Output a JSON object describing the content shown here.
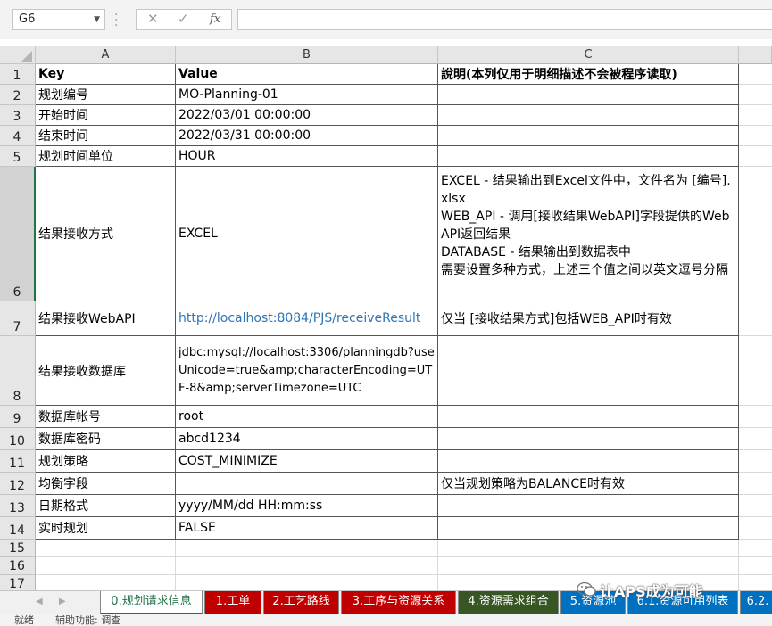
{
  "formula_bar": {
    "name_box": "G6",
    "cancel_icon": "✕",
    "enter_icon": "✓",
    "fx_label": "fx",
    "formula": ""
  },
  "columns": [
    "A",
    "B",
    "C"
  ],
  "rows": [
    {
      "num": "1",
      "a": "Key",
      "b": "Value",
      "c": "說明(本列仅用于明细描述不会被程序读取)"
    },
    {
      "num": "2",
      "a": "规划编号",
      "b": "MO-Planning-01",
      "c": ""
    },
    {
      "num": "3",
      "a": "开始时间",
      "b": "2022/03/01 00:00:00",
      "c": ""
    },
    {
      "num": "4",
      "a": "结束时间",
      "b": "2022/03/31 00:00:00",
      "c": ""
    },
    {
      "num": "5",
      "a": "规划时间单位",
      "b": " HOUR",
      "c": ""
    },
    {
      "num": "6",
      "a": "结果接收方式",
      "b": "EXCEL",
      "c": "EXCEL - 结果输出到Excel文件中，文件名为 [编号].xlsx\nWEB_API - 调用[接收结果WebAPI]字段提供的WebAPI返回结果\nDATABASE - 结果输出到数据表中\n需要设置多种方式，上述三个值之间以英文逗号分隔"
    },
    {
      "num": "7",
      "a": "结果接收WebAPI",
      "b": "http://localhost:8084/PJS/receiveResult",
      "c": "仅当 [接收结果方式]包括WEB_API时有效"
    },
    {
      "num": "8",
      "a": "结果接收数据库",
      "b": "jdbc:mysql://localhost:3306/planningdb?useUnicode=true&amp;characterEncoding=UTF-8&amp;serverTimezone=UTC",
      "c": ""
    },
    {
      "num": "9",
      "a": "数据库帐号",
      "b": " root",
      "c": ""
    },
    {
      "num": "10",
      "a": "数据库密码",
      "b": "abcd1234",
      "c": ""
    },
    {
      "num": "11",
      "a": "规划策略",
      "b": "COST_MINIMIZE",
      "c": ""
    },
    {
      "num": "12",
      "a": "均衡字段",
      "b": "",
      "c": "仅当规划策略为BALANCE时有效"
    },
    {
      "num": "13",
      "a": "日期格式",
      "b": " yyyy/MM/dd HH:mm:ss",
      "c": ""
    },
    {
      "num": "14",
      "a": "实时规划",
      "b": "FALSE",
      "c": ""
    },
    {
      "num": "15",
      "a": "",
      "b": "",
      "c": ""
    },
    {
      "num": "16",
      "a": "",
      "b": "",
      "c": ""
    },
    {
      "num": "17",
      "a": "",
      "b": "",
      "c": ""
    }
  ],
  "tabs": [
    {
      "label": "0.规划请求信息",
      "color": "#ffffff",
      "active": true
    },
    {
      "label": "1.工单",
      "color": "#c00000"
    },
    {
      "label": "2.工艺路线",
      "color": "#c00000"
    },
    {
      "label": "3.工序与资源关系",
      "color": "#c00000"
    },
    {
      "label": "4.资源需求组合",
      "color": "#375623"
    },
    {
      "label": "5.资源池",
      "color": "#0070c0"
    },
    {
      "label": "6.1.资源可用列表",
      "color": "#0070c0"
    },
    {
      "label": "6.2.",
      "color": "#0070c0"
    }
  ],
  "status": {
    "ready": "就绪",
    "accessibility": "辅助功能: 调查"
  },
  "watermark": "让APS成为可能",
  "colors": {
    "link": "#2f75b5",
    "active_tab_text": "#1e7145"
  }
}
